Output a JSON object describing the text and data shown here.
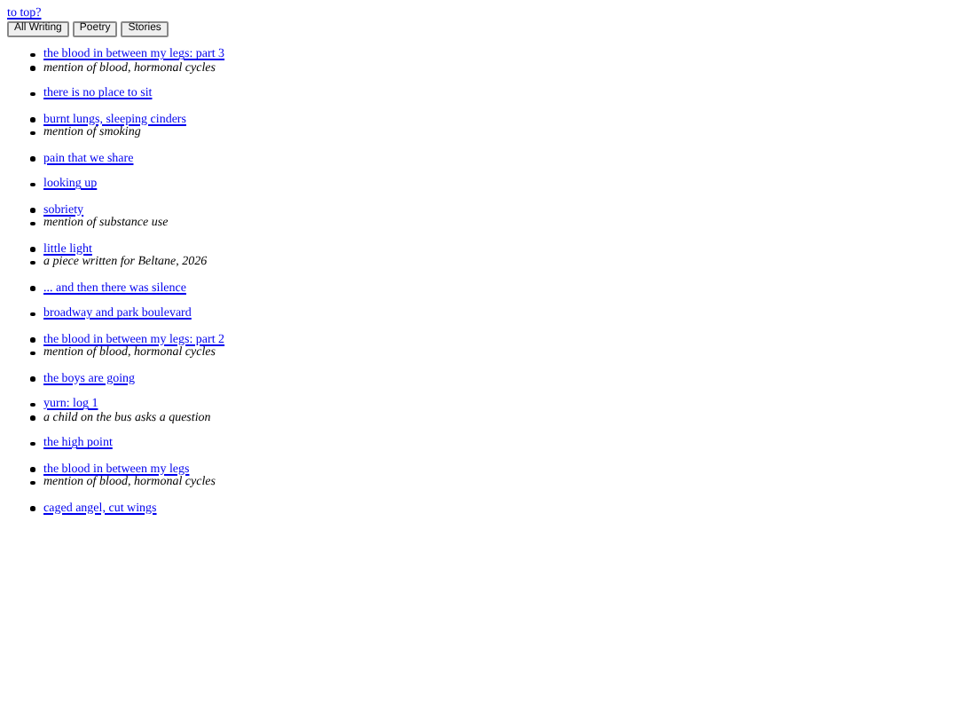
{
  "top_link": "to top?",
  "filters": [
    "All Writing",
    "Poetry",
    "Stories"
  ],
  "entries": [
    {
      "title": "the blood in between my legs: part 3",
      "note": "mention of blood, hormonal cycles"
    },
    {
      "title": "there is no place to sit"
    },
    {
      "title": "burnt lungs, sleeping cinders",
      "note": "mention of smoking"
    },
    {
      "title": "pain that we share"
    },
    {
      "title": "looking up"
    },
    {
      "title": "sobriety",
      "note": "mention of substance use"
    },
    {
      "title": "little light",
      "note": "a piece written for Beltane, 2026"
    },
    {
      "title": "... and then there was silence"
    },
    {
      "title": "broadway and park boulevard"
    },
    {
      "title": "the blood in between my legs: part 2",
      "note": "mention of blood, hormonal cycles"
    },
    {
      "title": "the boys are going"
    },
    {
      "title": "yurn: log 1",
      "note": "a child on the bus asks a question"
    },
    {
      "title": "the high point"
    },
    {
      "title": "the blood in between my legs",
      "note": "mention of blood, hormonal cycles"
    },
    {
      "title": "caged angel, cut wings"
    }
  ]
}
